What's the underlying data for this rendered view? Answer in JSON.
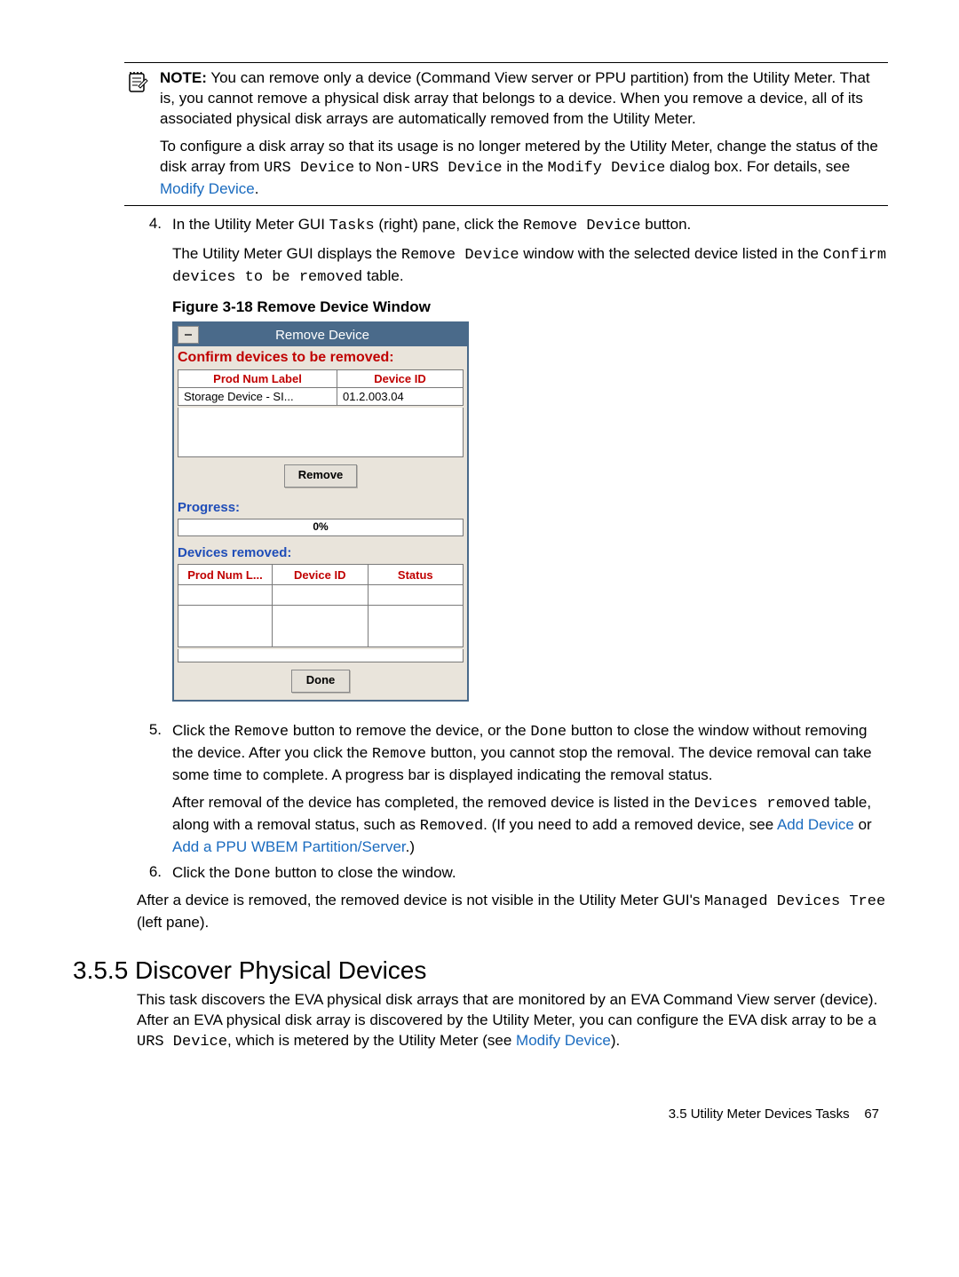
{
  "note": {
    "label": "NOTE:",
    "text1a": "You can remove only a device (Command View server or PPU partition) from the Utility Meter. That is, you cannot remove a physical disk array that belongs to a device. When you remove a device, all of its associated physical disk arrays are automatically removed from the Utility Meter.",
    "text2a": "To configure a disk array so that its usage is no longer metered by the Utility Meter, change the status of the disk array from ",
    "mono1": "URS Device",
    "text2b": " to ",
    "mono2": "Non-URS Device",
    "text2c": " in the ",
    "mono3": "Modify Device",
    "text2d": " dialog box. For details, see ",
    "link1": "Modify Device",
    "text2e": "."
  },
  "step4": {
    "num": "4.",
    "line1a": "In the Utility Meter GUI ",
    "mono1": "Tasks",
    "line1b": " (right) pane, click the ",
    "mono2": "Remove Device",
    "line1c": " button.",
    "line2a": "The Utility Meter GUI displays the ",
    "mono3": "Remove Device",
    "line2b": " window with the selected device listed in the ",
    "mono4": "Confirm devices to be removed",
    "line2c": " table."
  },
  "figure_caption": "Figure 3-18 Remove Device Window",
  "dialog": {
    "title": "Remove Device",
    "confirm_title": "Confirm devices to be removed:",
    "col_prod": "Prod Num Label",
    "col_dev": "Device ID",
    "row_prod": "Storage Device - SI...",
    "row_dev": "01.2.003.04",
    "remove_btn": "Remove",
    "progress_title": "Progress:",
    "progress_value": "0%",
    "removed_title": "Devices removed:",
    "col2_prod": "Prod Num L...",
    "col2_dev": "Device ID",
    "col2_status": "Status",
    "done_btn": "Done"
  },
  "step5": {
    "num": "5.",
    "line1a": "Click the ",
    "mono1": "Remove",
    "line1b": " button to remove the device, or the ",
    "mono2": "Done",
    "line1c": " button to close the window without removing the device. After you click the ",
    "mono3": "Remove",
    "line1d": " button, you cannot stop the removal. The device removal can take some time to complete. A progress bar is displayed indicating the removal status.",
    "line2a": "After removal of the device has completed, the removed device is listed in the ",
    "mono4": "Devices removed",
    "line2b": " table, along with a removal status, such as ",
    "mono5": "Removed",
    "line2c": ". (If you need to add a removed device, see ",
    "link1": "Add Device",
    "line2d": " or ",
    "link2": "Add a PPU WBEM Partition/Server",
    "line2e": ".)"
  },
  "step6": {
    "num": "6.",
    "line1a": "Click the ",
    "mono1": "Done",
    "line1b": " button to close the window."
  },
  "after": {
    "line1a": "After a device is removed, the removed device is not visible in the Utility Meter GUI's ",
    "mono1": "Managed Devices Tree",
    "line1b": " (left pane)."
  },
  "section": {
    "title": "3.5.5 Discover Physical Devices",
    "body1": "This task discovers the EVA physical disk arrays that are monitored by an EVA Command View server (device). After an EVA physical disk array is discovered by the Utility Meter, you can configure the EVA disk array to be a ",
    "mono1": "URS Device",
    "body2": ", which is metered by the Utility Meter (see ",
    "link1": "Modify Device",
    "body3": ")."
  },
  "footer": {
    "label": "3.5 Utility Meter Devices Tasks",
    "page": "67"
  }
}
